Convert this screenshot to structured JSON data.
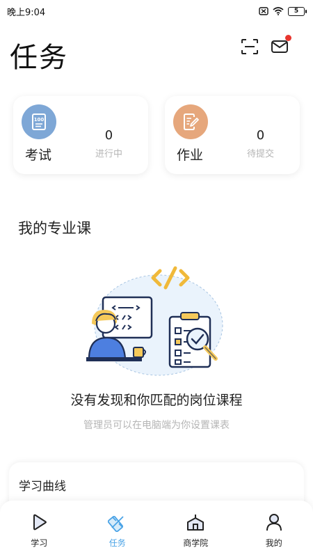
{
  "status_bar": {
    "time": "晚上9:04",
    "battery": "5"
  },
  "header": {
    "title": "任务"
  },
  "cards": [
    {
      "label": "考试",
      "count": "0",
      "status": "进行中",
      "icon": "exam-icon"
    },
    {
      "label": "作业",
      "count": "0",
      "status": "待提交",
      "icon": "homework-icon"
    }
  ],
  "section": {
    "title": "我的专业课"
  },
  "empty_state": {
    "title": "没有发现和你匹配的岗位课程",
    "subtitle": "管理员可以在电脑端为你设置课表"
  },
  "curve": {
    "title": "学习曲线"
  },
  "nav": [
    {
      "label": "学习",
      "icon": "play-icon",
      "active": false
    },
    {
      "label": "任务",
      "icon": "task-icon",
      "active": true
    },
    {
      "label": "商学院",
      "icon": "school-icon",
      "active": false
    },
    {
      "label": "我的",
      "icon": "person-icon",
      "active": false
    }
  ],
  "colors": {
    "accent": "#4aa3e6",
    "exam": "#7ea7d6",
    "homework": "#e6a77c",
    "notify": "#e8352e"
  }
}
